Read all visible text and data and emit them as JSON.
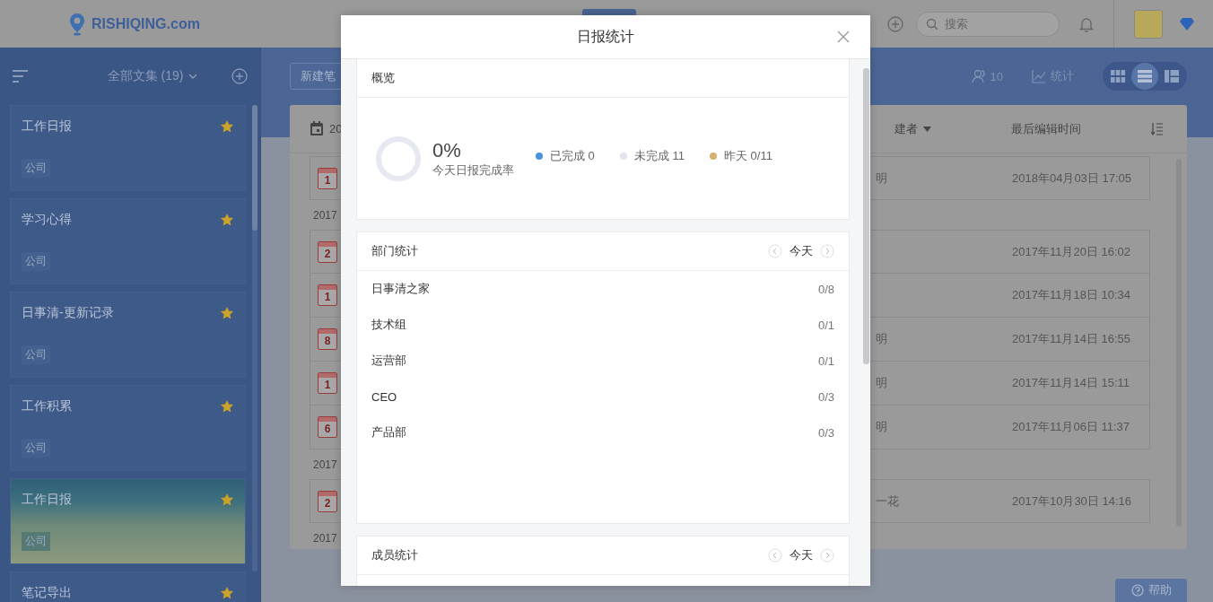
{
  "header": {
    "logo_text": "RISHIQING.com",
    "search": {
      "placeholder": "搜索"
    }
  },
  "sidebar": {
    "collection_selector": "全部文集 (19)",
    "notebooks": [
      {
        "title": "工作日报",
        "tag": "公司",
        "starred": true,
        "kind": "plain"
      },
      {
        "title": "学习心得",
        "tag": "公司",
        "starred": true,
        "kind": "plain"
      },
      {
        "title": "日事清-更新记录",
        "tag": "公司",
        "starred": true,
        "kind": "plain"
      },
      {
        "title": "工作积累",
        "tag": "公司",
        "starred": true,
        "kind": "plain"
      },
      {
        "title": "工作日报",
        "tag": "公司",
        "starred": true,
        "kind": "picture"
      },
      {
        "title": "笔记导出",
        "starred": true,
        "kind": "plain"
      }
    ]
  },
  "toolbar": {
    "new_note_button": "新建笔",
    "member_count": "10",
    "stats_label": "统计",
    "view_modes": [
      {
        "kind": "grid",
        "selected": false
      },
      {
        "kind": "list",
        "selected": true
      },
      {
        "kind": "split",
        "selected": false
      }
    ]
  },
  "table": {
    "columns": {
      "column_1": "20",
      "creator": "建者",
      "last_edited": "最后编辑时间"
    },
    "rows": [
      {
        "kind": "note",
        "day": "1",
        "creator": "明",
        "time": "2018年04月03日 17:05"
      },
      {
        "kind": "group",
        "label": "2017"
      },
      {
        "kind": "note",
        "day": "2",
        "time": "2017年11月20日 16:02"
      },
      {
        "kind": "note",
        "day": "1",
        "time": "2017年11月18日 10:34"
      },
      {
        "kind": "note",
        "day": "8",
        "creator": "明",
        "time": "2017年11月14日 16:55"
      },
      {
        "kind": "note",
        "day": "1",
        "creator": "明",
        "time": "2017年11月14日 15:11"
      },
      {
        "kind": "note",
        "day": "6",
        "creator": "明",
        "time": "2017年11月06日 11:37"
      },
      {
        "kind": "group",
        "label": "2017"
      },
      {
        "kind": "note",
        "day": "2",
        "creator": "一花",
        "time": "2017年10月30日 14:16"
      },
      {
        "kind": "group",
        "label": "2017"
      }
    ]
  },
  "help_button": "帮助",
  "dialog": {
    "title": "日报统计",
    "overview": {
      "title": "概览",
      "rate": "0%",
      "rate_label": "今天日报完成率",
      "level": 0,
      "legend": [
        {
          "label": "已完成 0",
          "color": "#4a90e2"
        },
        {
          "label": "未完成 11",
          "color": "#e3e5ee"
        },
        {
          "label": "昨天 0/11",
          "color": "#d6b06e"
        }
      ]
    },
    "departments": {
      "title": "部门统计",
      "period": "今天",
      "rows": [
        {
          "name": "日事清之家",
          "count": "0/8"
        },
        {
          "name": "技术组",
          "count": "0/1"
        },
        {
          "name": "运营部",
          "count": "0/1"
        },
        {
          "name": "CEO",
          "count": "0/3"
        },
        {
          "name": "产品部",
          "count": "0/3"
        }
      ]
    },
    "members": {
      "title": "成员统计",
      "period": "今天"
    }
  }
}
